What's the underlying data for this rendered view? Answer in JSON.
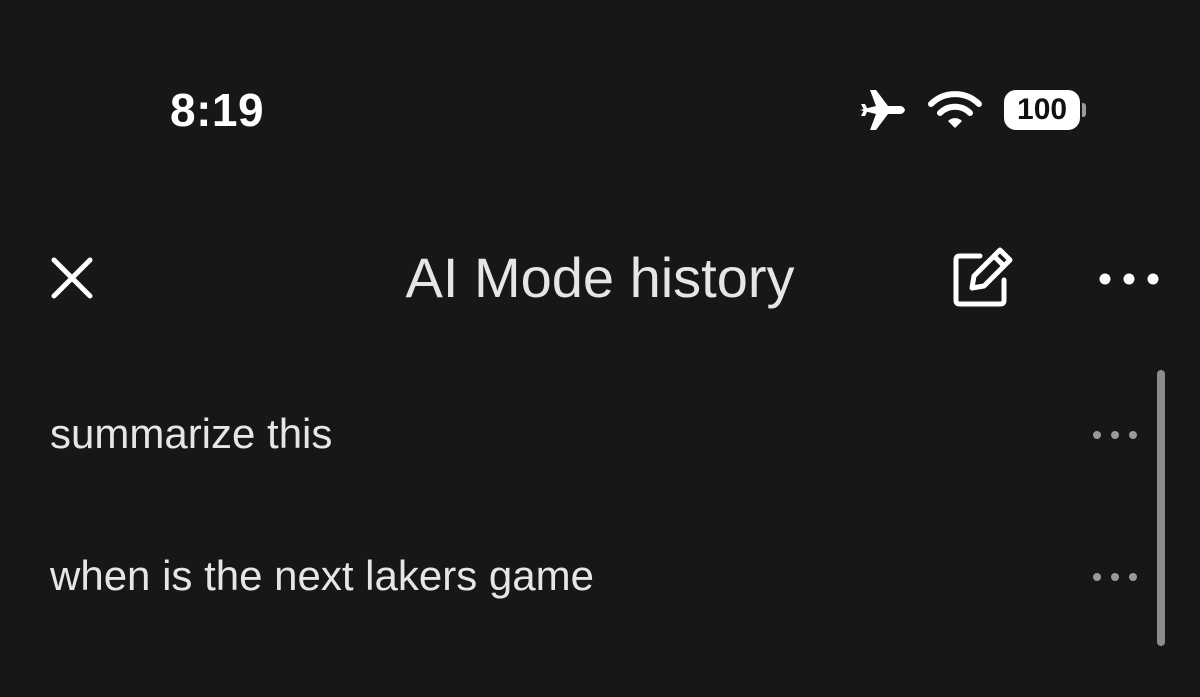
{
  "status_bar": {
    "time": "8:19",
    "battery_level": "100",
    "icons": [
      "airplane-icon",
      "wifi-icon",
      "battery-icon"
    ]
  },
  "header": {
    "title": "AI Mode history",
    "icons": [
      "close-icon",
      "edit-icon",
      "more-horizontal-icon"
    ]
  },
  "history": {
    "items": [
      {
        "label": "summarize this"
      },
      {
        "label": "when is the next lakers game"
      }
    ]
  },
  "colors": {
    "background": "#171717",
    "text": "#e6e6e6",
    "icon": "#ffffff",
    "scrollbar": "#8c8c8c"
  }
}
